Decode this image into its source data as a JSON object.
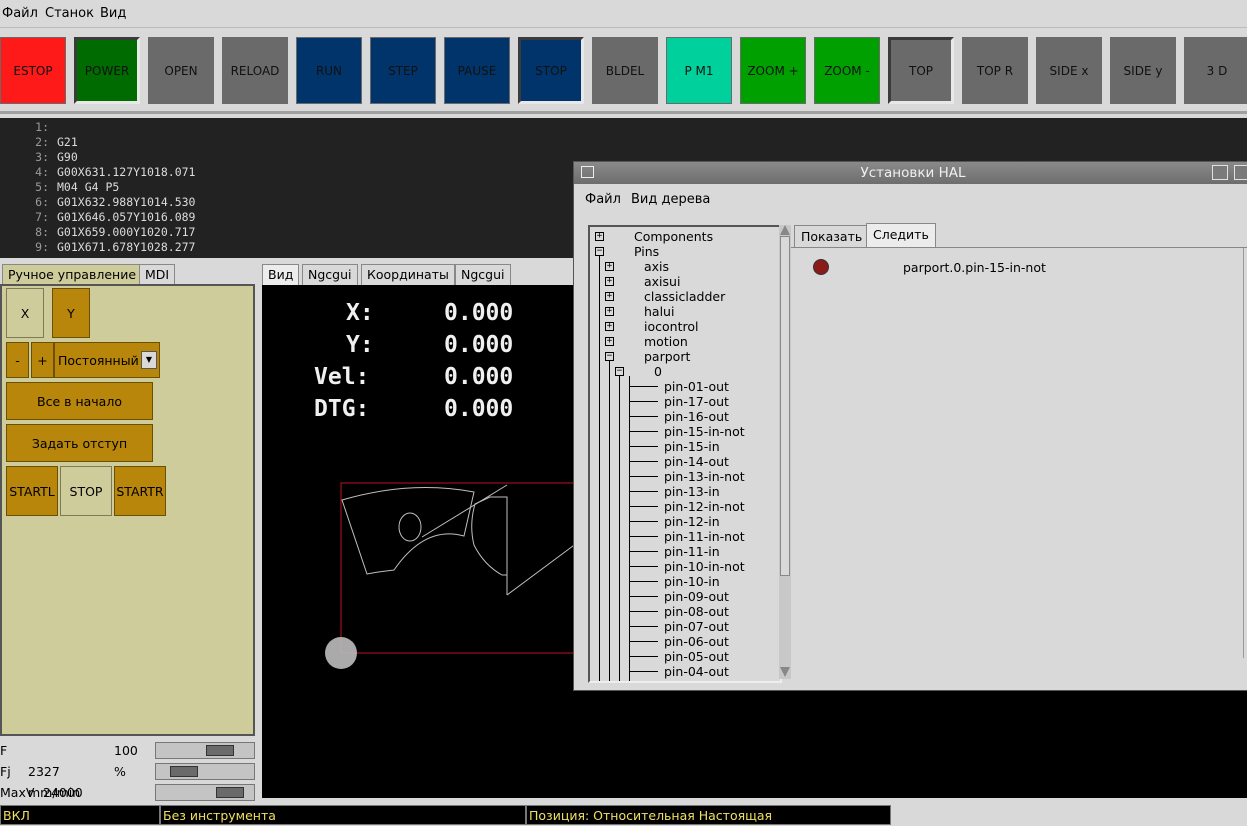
{
  "menubar": [
    "Файл",
    "Станок",
    "Вид"
  ],
  "toolbar": [
    {
      "label": "ESTOP",
      "bg": "#ff1a1a"
    },
    {
      "label": "POWER",
      "bg": "#006b00"
    },
    {
      "label": "OPEN",
      "bg": "#6a6a6a"
    },
    {
      "label": "RELOAD",
      "bg": "#6a6a6a"
    },
    {
      "label": "RUN",
      "bg": "#00346a"
    },
    {
      "label": "STEP",
      "bg": "#00346a"
    },
    {
      "label": "PAUSE",
      "bg": "#00346a"
    },
    {
      "label": "STOP",
      "bg": "#00346a"
    },
    {
      "label": "BLDEL",
      "bg": "#6a6a6a"
    },
    {
      "label": "P M1",
      "bg": "#00d09c"
    },
    {
      "label": "ZOOM +",
      "bg": "#00a000"
    },
    {
      "label": "ZOOM -",
      "bg": "#00a000"
    },
    {
      "label": "TOP",
      "bg": "#6a6a6a"
    },
    {
      "label": "TOP R",
      "bg": "#6a6a6a"
    },
    {
      "label": "SIDE x",
      "bg": "#6a6a6a"
    },
    {
      "label": "SIDE y",
      "bg": "#6a6a6a"
    },
    {
      "label": "3 D",
      "bg": "#6a6a6a"
    }
  ],
  "gcode": [
    {
      "n": "1:",
      "t": ""
    },
    {
      "n": "2:",
      "t": "G21"
    },
    {
      "n": "3:",
      "t": "G90"
    },
    {
      "n": "4:",
      "t": "G00X631.127Y1018.071"
    },
    {
      "n": "5:",
      "t": "M04 G4 P5"
    },
    {
      "n": "6:",
      "t": "G01X632.988Y1014.530"
    },
    {
      "n": "7:",
      "t": "G01X646.057Y1016.089"
    },
    {
      "n": "8:",
      "t": "G01X659.000Y1020.717"
    },
    {
      "n": "9:",
      "t": "G01X671.678Y1028.277"
    }
  ],
  "left_tabs": {
    "manual": "Ручное управление",
    "mdi": "MDI"
  },
  "manual": {
    "axis_x": "X",
    "axis_y": "Y",
    "minus": "-",
    "plus": "+",
    "jog_mode": "Постоянный",
    "home_all": "Все в начало",
    "touch_off": "Задать отступ",
    "startl": "STARTL",
    "stop": "STOP",
    "startr": "STARTR"
  },
  "sliders": [
    {
      "label": "F",
      "value": "100 %",
      "fraction": 0.72
    },
    {
      "label": "Fj",
      "value": "2327 mm/min",
      "fraction": 0.2
    },
    {
      "label": "MaxV",
      "value": "24000 mm/min",
      "fraction": 0.86
    }
  ],
  "preview_tabs": [
    "Вид",
    "Ngcgui",
    "Координаты",
    "Ngcgui"
  ],
  "dro": [
    {
      "label": "X:",
      "value": "0.000"
    },
    {
      "label": "Y:",
      "value": "0.000"
    },
    {
      "label": "Vel:",
      "value": "0.000"
    },
    {
      "label": "DTG:",
      "value": "0.000"
    }
  ],
  "status": {
    "machine": "ВКЛ",
    "tool": "Без инструмента",
    "position": "Позиция: Относительная Настоящая"
  },
  "hal": {
    "title": "Установки HAL",
    "menu": [
      "Файл",
      "Вид дерева"
    ],
    "tabs": {
      "show": "Показать",
      "watch": "Следить"
    },
    "watch_item": "parport.0.pin-15-in-not",
    "tree": {
      "components": "Components",
      "pins": "Pins",
      "groups": [
        "axis",
        "axisui",
        "classicladder",
        "halui",
        "iocontrol",
        "motion",
        "parport"
      ],
      "parport_child": "0",
      "parport_pins": [
        "pin-01-out",
        "pin-17-out",
        "pin-16-out",
        "pin-15-in-not",
        "pin-15-in",
        "pin-14-out",
        "pin-13-in-not",
        "pin-13-in",
        "pin-12-in-not",
        "pin-12-in",
        "pin-11-in-not",
        "pin-11-in",
        "pin-10-in-not",
        "pin-10-in",
        "pin-09-out",
        "pin-08-out",
        "pin-07-out",
        "pin-06-out",
        "pin-05-out",
        "pin-04-out"
      ]
    }
  }
}
